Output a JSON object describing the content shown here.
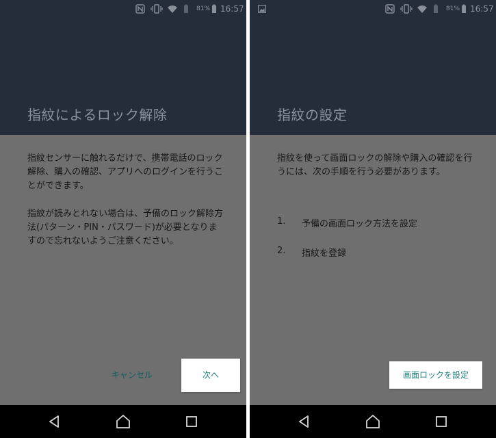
{
  "status_bar": {
    "battery_percent": "81%",
    "time": "16:57",
    "icons": [
      "nfc-icon",
      "vibrate-icon",
      "wifi-icon",
      "battery-icon"
    ],
    "right_screen_extra_icon": "image-notification-icon"
  },
  "left_screen": {
    "title": "指紋によるロック解除",
    "paragraph1": "指紋センサーに触れるだけで、携帯電話のロック解除、購入の確認、アプリへのログインを行うことができます。",
    "paragraph2": "指紋が読みとれない場合は、予備のロック解除方法(パターン・PIN・パスワード)が必要となりますので忘れないようご注意ください。",
    "cancel_label": "キャンセル",
    "next_label": "次へ"
  },
  "right_screen": {
    "title": "指紋の設定",
    "paragraph": "指紋を使って画面ロックの解除や購入の確認を行うには、次の手順を行う必要があります。",
    "steps": [
      {
        "number": "1.",
        "label": "予備の画面ロック方法を設定"
      },
      {
        "number": "2.",
        "label": "指紋を登録"
      }
    ],
    "set_lock_label": "画面ロックを設定"
  },
  "colors": {
    "header": "#252d3b",
    "dim_overlay": "#6f6f6f",
    "accent": "#1d7f7a",
    "nav_bar": "#000000"
  },
  "nav_bar": {
    "icons": [
      "back-icon",
      "home-icon",
      "recents-icon"
    ]
  }
}
